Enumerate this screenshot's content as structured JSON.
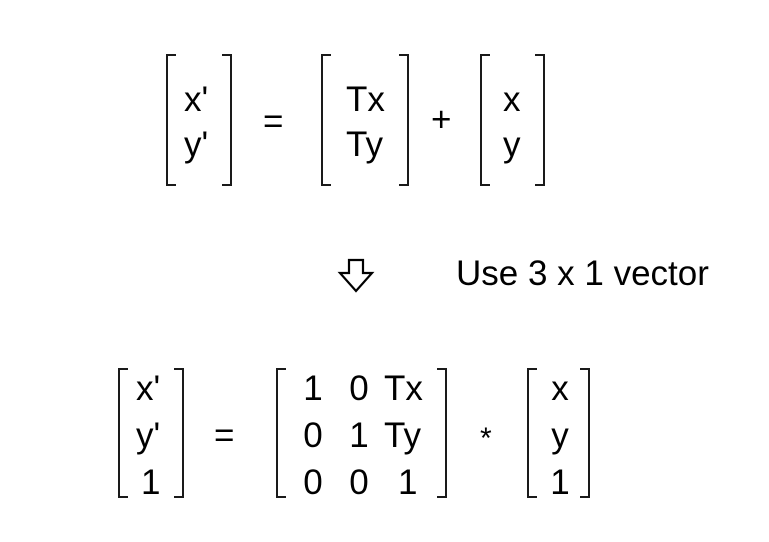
{
  "eq1": {
    "lhs": [
      "x'",
      "y'"
    ],
    "equals": "=",
    "translation": [
      "Tx",
      "Ty"
    ],
    "plus": "+",
    "vector": [
      "x",
      "y"
    ]
  },
  "arrow": {
    "icon": "down-arrow-icon",
    "label": "Use 3 x 1 vector"
  },
  "eq2": {
    "lhs": [
      "x'",
      "y'",
      "1"
    ],
    "equals": "=",
    "matrix": [
      [
        "1",
        "0",
        "Tx"
      ],
      [
        "0",
        "1",
        "Ty"
      ],
      [
        "0",
        "0",
        "1"
      ]
    ],
    "times": "*",
    "vector": [
      "x",
      "y",
      "1"
    ]
  },
  "colors": {
    "ink": "#000000",
    "bracket": "#1a1a1a",
    "background": "#ffffff"
  }
}
